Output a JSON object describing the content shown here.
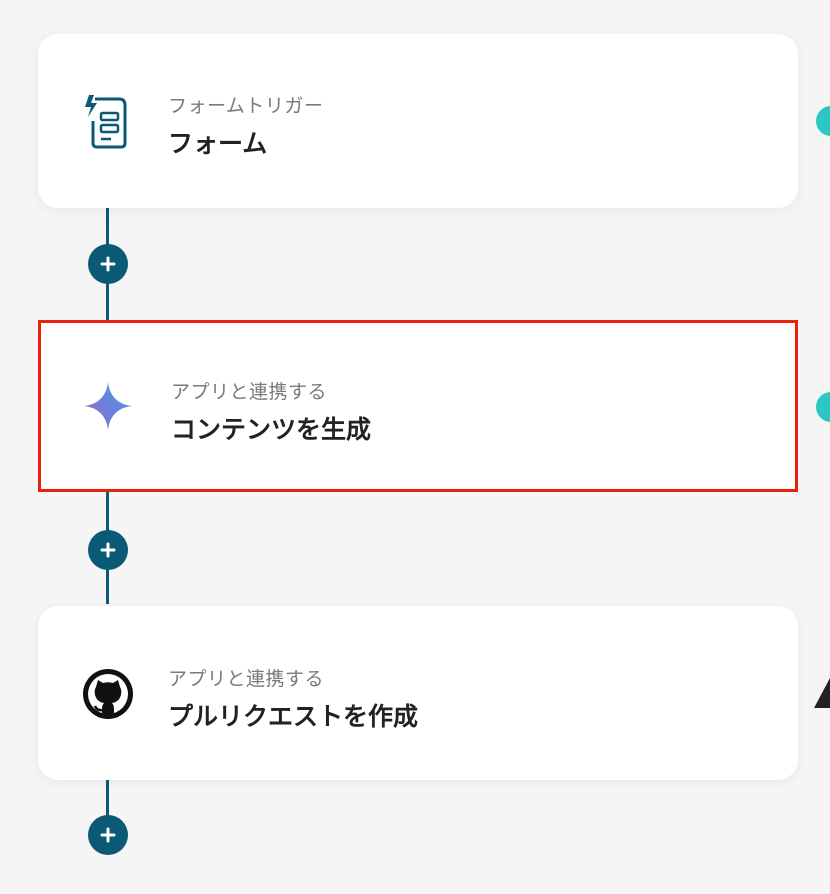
{
  "steps": [
    {
      "subtitle": "フォームトリガー",
      "title": "フォーム",
      "icon": "form-trigger-icon"
    },
    {
      "subtitle": "アプリと連携する",
      "title": "コンテンツを生成",
      "icon": "gemini-sparkle-icon",
      "selected": true
    },
    {
      "subtitle": "アプリと連携する",
      "title": "プルリクエストを作成",
      "icon": "github-icon"
    }
  ],
  "colors": {
    "connector": "#0b5a75",
    "selection_border": "#e8230a",
    "status_ok": "#2bc7c2",
    "background": "#f5f5f5"
  }
}
